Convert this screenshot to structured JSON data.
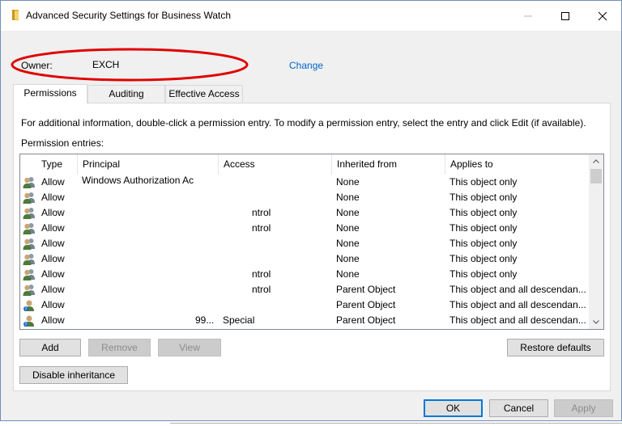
{
  "window": {
    "title": "Advanced Security Settings for Business Watch"
  },
  "owner": {
    "label": "Owner:",
    "value": "EXCH",
    "change_link": "Change",
    "highlight_color": "#e00000"
  },
  "tabs": [
    {
      "label": "Permissions",
      "active": true
    },
    {
      "label": "Auditing",
      "active": false
    },
    {
      "label": "Effective Access",
      "active": false
    }
  ],
  "permissions": {
    "info_text": "For additional information, double-click a permission entry. To modify a permission entry, select the entry and click Edit (if available).",
    "entries_label": "Permission entries:",
    "columns": [
      "Type",
      "Principal",
      "Access",
      "Inherited from",
      "Applies to"
    ],
    "rows": [
      {
        "icon": "group-icon",
        "type": "Allow",
        "principal": "Windows Authorization Ac",
        "access": "",
        "inherited": "None",
        "applies": "This object only"
      },
      {
        "icon": "group-icon",
        "type": "Allow",
        "principal": "",
        "access": "",
        "inherited": "None",
        "applies": "This object only"
      },
      {
        "icon": "group-icon",
        "type": "Allow",
        "principal": "",
        "access": "ntrol",
        "inherited": "None",
        "applies": "This object only"
      },
      {
        "icon": "group-icon",
        "type": "Allow",
        "principal": "",
        "access": "ntrol",
        "inherited": "None",
        "applies": "This object only"
      },
      {
        "icon": "group-icon",
        "type": "Allow",
        "principal": "",
        "access": "",
        "inherited": "None",
        "applies": "This object only"
      },
      {
        "icon": "group-icon",
        "type": "Allow",
        "principal": "",
        "access": "",
        "inherited": "None",
        "applies": "This object only"
      },
      {
        "icon": "group-icon",
        "type": "Allow",
        "principal": "",
        "access": "ntrol",
        "inherited": "None",
        "applies": "This object only"
      },
      {
        "icon": "group-icon",
        "type": "Allow",
        "principal": "",
        "access": "ntrol",
        "inherited": "Parent Object",
        "applies": "This object and all descendan..."
      },
      {
        "icon": "user-icon",
        "type": "Allow",
        "principal": "",
        "access": "",
        "inherited": "Parent Object",
        "applies": "This object and all descendan..."
      },
      {
        "icon": "user-icon",
        "type": "Allow",
        "principal": "99...",
        "access": "Special",
        "inherited": "Parent Object",
        "applies": "This object and all descendan..."
      }
    ]
  },
  "buttons": {
    "add": "Add",
    "remove": "Remove",
    "view": "View",
    "restore_defaults": "Restore defaults",
    "disable_inheritance": "Disable inheritance",
    "ok": "OK",
    "cancel": "Cancel",
    "apply": "Apply"
  },
  "colors": {
    "link": "#0066cc",
    "accent": "#0078d7"
  }
}
